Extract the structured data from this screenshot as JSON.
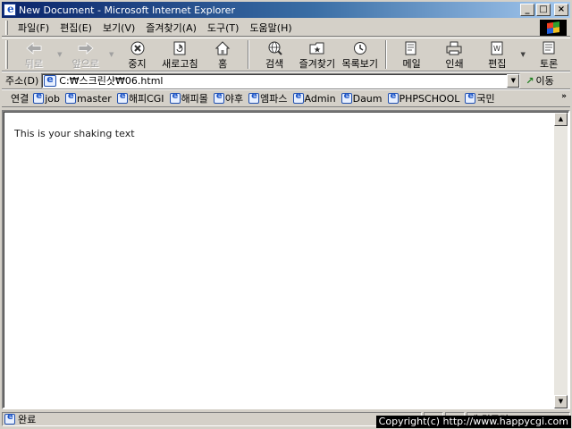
{
  "window": {
    "title": "New Document - Microsoft Internet Explorer",
    "minimize": "_",
    "maximize": "□",
    "close": "×"
  },
  "menu": [
    "파일(F)",
    "편집(E)",
    "보기(V)",
    "즐겨찾기(A)",
    "도구(T)",
    "도움말(H)"
  ],
  "toolbar": {
    "back": "뒤로",
    "forward": "앞으로",
    "stop": "중지",
    "refresh": "새로고침",
    "home": "홈",
    "search": "검색",
    "favorites": "즐겨찾기",
    "history": "목록보기",
    "mail": "메일",
    "print": "인쇄",
    "edit": "편집",
    "discuss": "토론"
  },
  "address": {
    "label": "주소(D)",
    "value": "C:₩스크린샷₩06.html",
    "go": "이동"
  },
  "links": {
    "label": "연결",
    "items": [
      "job",
      "master",
      "해피CGI",
      "해피몰",
      "야후",
      "엠파스",
      "Admin",
      "Daum",
      "PHPSCHOOL",
      "국민"
    ]
  },
  "page": {
    "text": "This is your shaking text"
  },
  "status": {
    "text": "완료",
    "zone": "내 컴퓨터"
  },
  "overlay": {
    "copyright": "Copyright(c) http://www.happycgi.com"
  },
  "colors": {
    "title_start": "#0a246a",
    "title_end": "#a6caf0",
    "chrome": "#d4d0c8"
  }
}
